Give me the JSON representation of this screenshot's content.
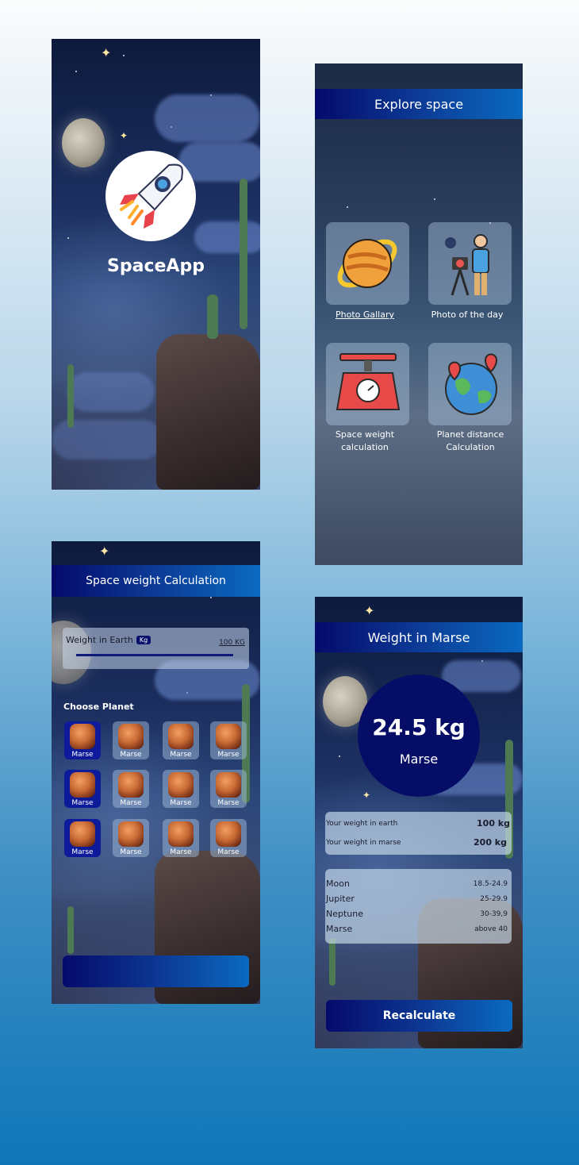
{
  "splash": {
    "app_name": "SpaceApp",
    "logo_icon": "rocket-icon"
  },
  "explore": {
    "title": "Explore space",
    "tiles": [
      {
        "label": "Photo Gallary",
        "icon": "saturn-planet-icon",
        "underlined": true
      },
      {
        "label": "Photo of the day",
        "icon": "astronaut-photographer-icon"
      },
      {
        "label": "Space weight calculation",
        "icon": "weighing-scale-icon"
      },
      {
        "label": "Planet distance Calculation",
        "icon": "globe-location-pins-icon"
      }
    ]
  },
  "calc": {
    "title": "Space weight Calculation",
    "weight_label": "Weight in Earth",
    "unit_badge": "Kg",
    "weight_value": "100 KG",
    "choose_label": "Choose Planet",
    "planets": [
      {
        "label": "Marse",
        "selected": true
      },
      {
        "label": "Marse"
      },
      {
        "label": "Marse"
      },
      {
        "label": "Marse"
      },
      {
        "label": "Marse",
        "selected": true
      },
      {
        "label": "Marse"
      },
      {
        "label": "Marse"
      },
      {
        "label": "Marse"
      },
      {
        "label": "Marse",
        "selected": true
      },
      {
        "label": "Marse"
      },
      {
        "label": "Marse"
      },
      {
        "label": "Marse"
      }
    ]
  },
  "result": {
    "title": "Weight in Marse",
    "value": "24.5 kg",
    "planet": "Marse",
    "earth_label": "Your weight in earth",
    "earth_value": "100 kg",
    "planet_label": "Your weight in marse",
    "planet_value": "200 kg",
    "ranges": [
      {
        "name": "Moon",
        "range": "18.5-24.9"
      },
      {
        "name": "Jupiter",
        "range": "25-29.9"
      },
      {
        "name": "Neptune",
        "range": "30-39,9"
      },
      {
        "name": "Marse",
        "range": "above 40"
      }
    ],
    "button": "Recalculate"
  },
  "colors": {
    "header_start": "#050a6b",
    "header_end": "#0a6ac0",
    "result_circle": "#060d66"
  }
}
